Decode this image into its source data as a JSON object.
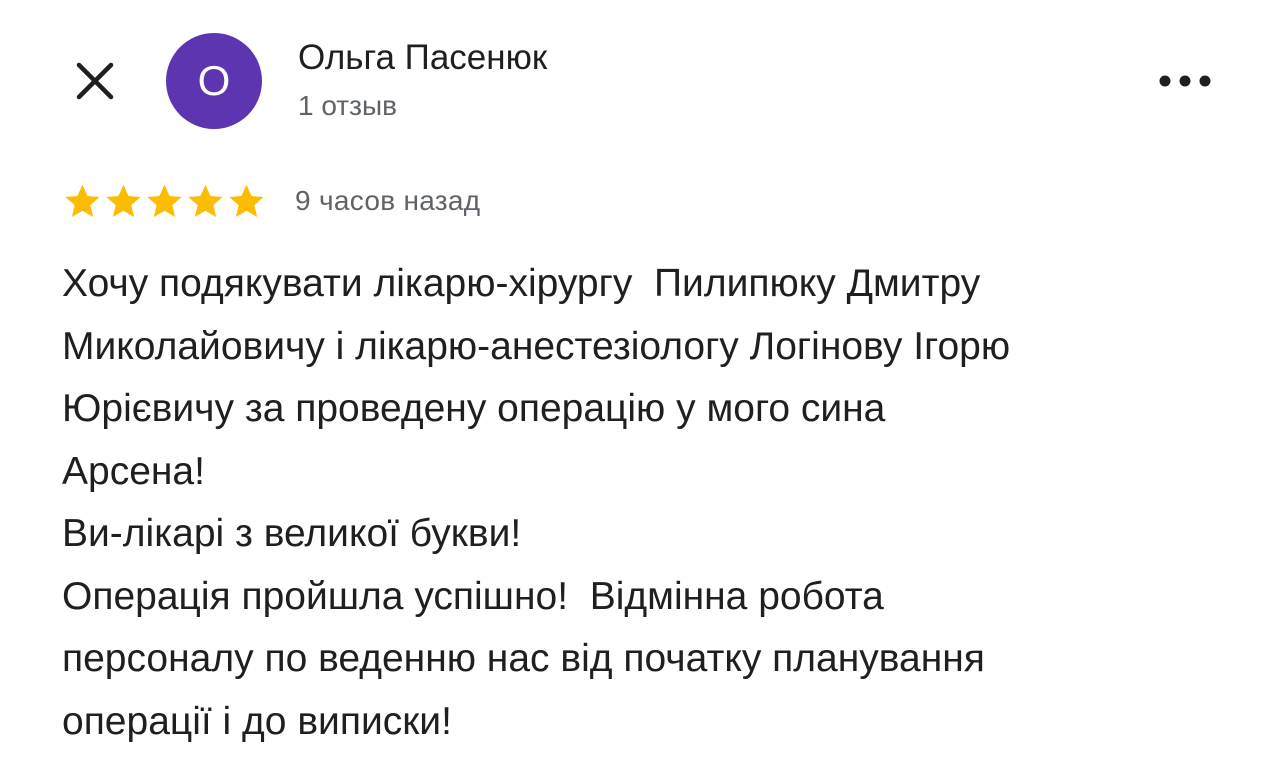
{
  "header": {
    "author_name": "Ольга Пасенюк",
    "review_count": "1 отзыв",
    "avatar_initial": "О",
    "avatar_color": "#5e35b1",
    "close_icon": "close-icon",
    "more_icon": "more-vert-icon"
  },
  "review": {
    "rating": 5,
    "max_rating": 5,
    "star_color": "#fbbc04",
    "time": "9 часов назад",
    "lines": [
      "Хочу подякувати лікарю-хірургу  Пилипюку Дмитру",
      "Миколайовичу і лікарю-анестезіологу Логінову Ігорю",
      "Юрієвичу за проведену операцію у мого сина",
      "Арсена!",
      "Ви-лікарі з великої букви!",
      "Операція пройшла успішно!  Відмінна робота",
      "персоналу по веденню нас від початку планування",
      "операції і до виписки!"
    ]
  }
}
